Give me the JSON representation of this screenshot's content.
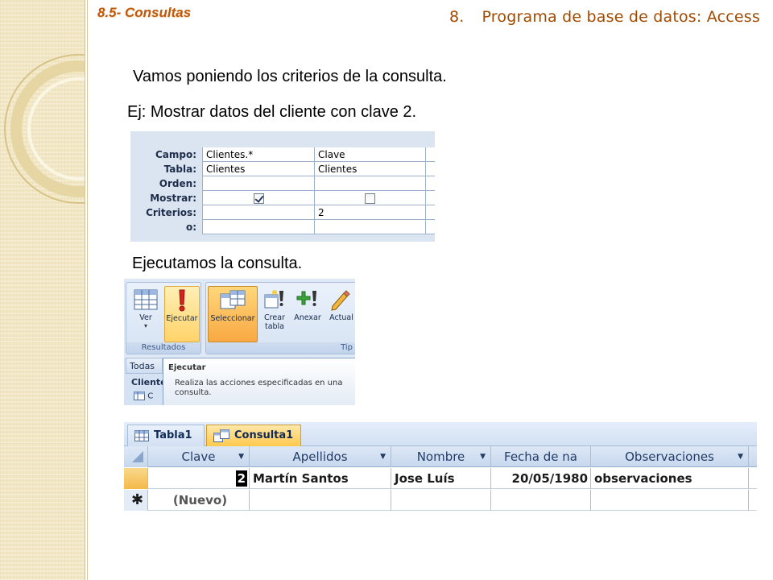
{
  "slide": {
    "section_label": "8.5- Consultas",
    "chapter_number": "8.",
    "chapter_title": "Programa de base de datos: Access",
    "line1": "Vamos poniendo los criterios de la consulta.",
    "line2": "Ej: Mostrar datos del cliente con clave 2.",
    "line3": "Ejecutamos la consulta."
  },
  "query_grid": {
    "row_labels": [
      "Campo:",
      "Tabla:",
      "Orden:",
      "Mostrar:",
      "Criterios:",
      "o:"
    ],
    "col1": {
      "campo": "Clientes.*",
      "tabla": "Clientes",
      "orden": "",
      "mostrar": true,
      "criterios": "",
      "o": ""
    },
    "col2": {
      "campo": "Clave",
      "tabla": "Clientes",
      "orden": "",
      "mostrar": false,
      "criterios": "2",
      "o": ""
    }
  },
  "ribbon": {
    "groups": [
      "Resultados",
      "Tip"
    ],
    "buttons": {
      "ver": "Ver",
      "ejecutar": "Ejecutar",
      "seleccionar": "Seleccionar",
      "crear_tabla_1": "Crear",
      "crear_tabla_2": "tabla",
      "anexar": "Anexar",
      "actualizar": "Actual"
    },
    "nav_tab": "Todas",
    "nav_item": "Cliente",
    "nav_row": "C",
    "tooltip_title": "Ejecutar",
    "tooltip_body_1": "Realiza las acciones especificadas en una",
    "tooltip_body_2": "consulta."
  },
  "datasheet": {
    "tabs": [
      "Tabla1",
      "Consulta1"
    ],
    "columns": [
      "Clave",
      "Apellidos",
      "Nombre",
      "Fecha de na",
      "Observaciones"
    ],
    "row": {
      "clave": "2",
      "apellidos": "Martín Santos",
      "nombre": "Jose Luís",
      "fecha": "20/05/1980",
      "observaciones": "observaciones"
    },
    "new_row": {
      "marker": "✱",
      "clave": "(Nuevo)"
    }
  },
  "colors": {
    "section_label": "#c0580d",
    "chapter_title": "#a24a00",
    "side_band": "#f1e6c4",
    "ribbon_highlight": "#ffd36a"
  }
}
